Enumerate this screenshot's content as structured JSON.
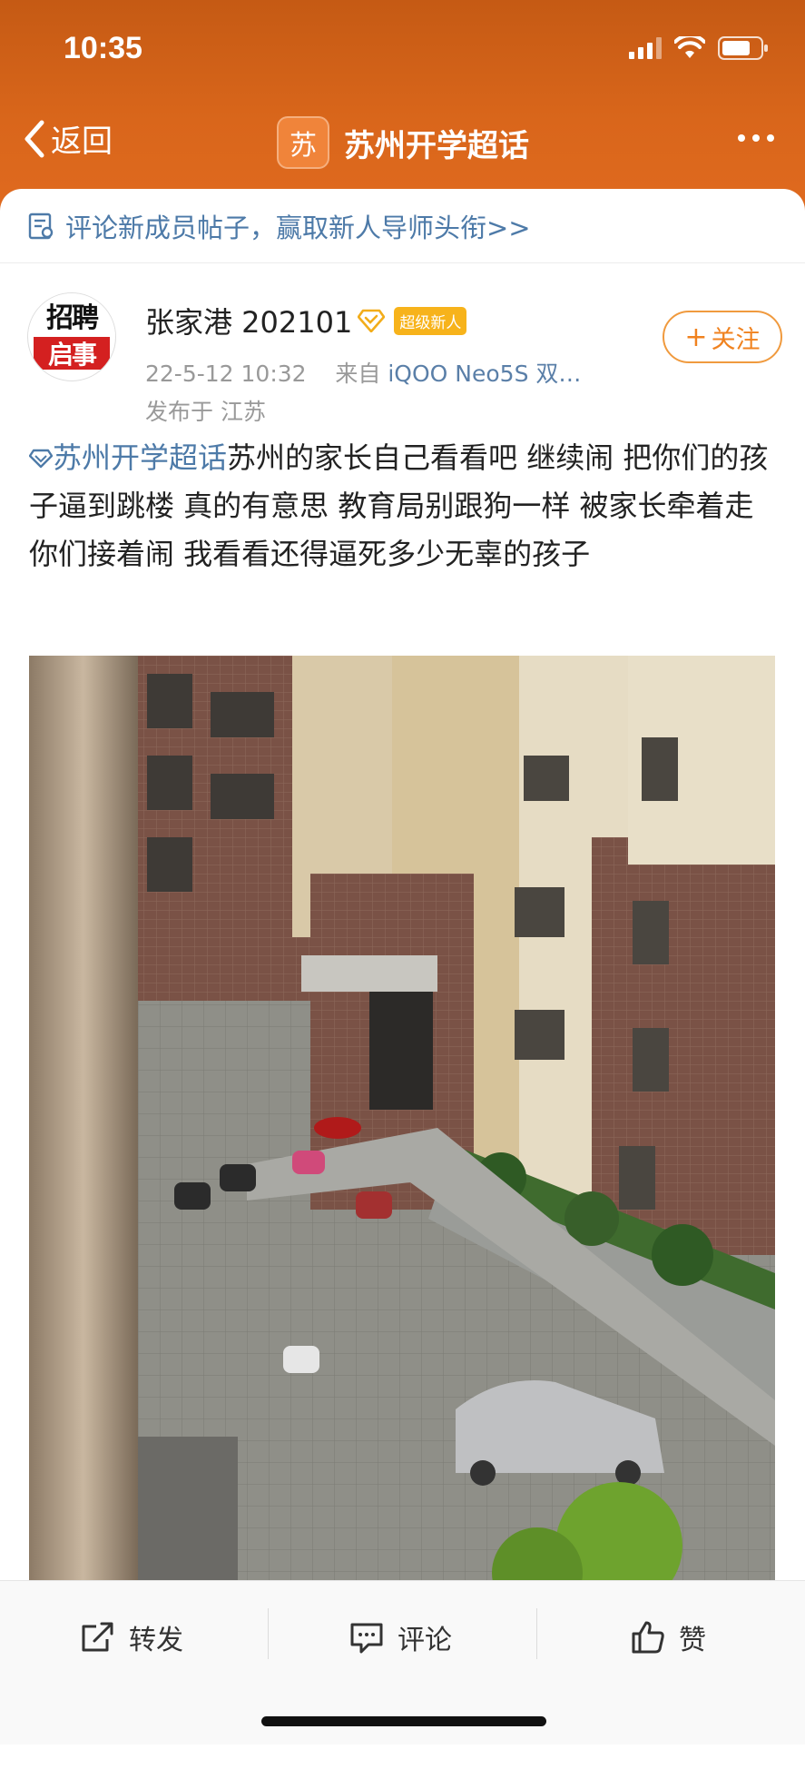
{
  "status": {
    "time": "10:35"
  },
  "nav": {
    "back_label": "返回",
    "topic_badge": "苏",
    "topic_name": "苏州开学超话"
  },
  "notice": {
    "text": "评论新成员帖子，赢取新人导师头衔>>"
  },
  "author": {
    "avatar_top": "招聘",
    "avatar_bottom": "启事",
    "name": "张家港 202101",
    "badge": "超级新人",
    "date": "22-5-12 10:32",
    "from_label": "来自",
    "device": "iQOO Neo5S 双…",
    "location": "发布于 江苏",
    "follow_label": "关注"
  },
  "post": {
    "topic": "苏州开学超话",
    "text": "苏州的家长自己看看吧  继续闹  把你们的孩子逼到跳楼 真的有意思 教育局别跟狗一样 被家长牵着走 你们接着闹 我看看还得逼死多少无辜的孩子"
  },
  "actions": {
    "repost": "转发",
    "comment": "评论",
    "like": "赞"
  },
  "colors": {
    "header": "#d9661b",
    "link": "#4d7aa8",
    "follow": "#f0821f"
  },
  "icons": [
    "back-arrow-icon",
    "more-icon",
    "notice-icon",
    "verified-icon",
    "repost-icon",
    "comment-icon",
    "like-icon",
    "signal-icon",
    "wifi-icon",
    "battery-icon",
    "topic-diamond-icon"
  ]
}
